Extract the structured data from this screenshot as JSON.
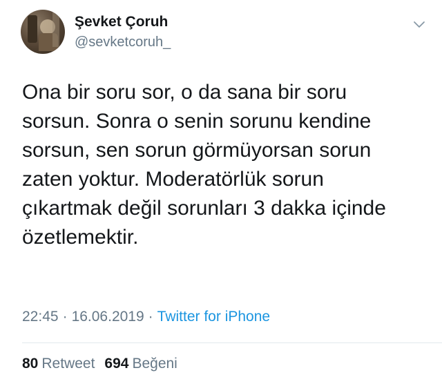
{
  "tweet": {
    "author": {
      "display_name": "Şevket Çoruh",
      "handle": "@sevketcoruh_"
    },
    "text": "Ona bir soru sor, o da sana bir soru\nsorsun. Sonra o senin sorunu kendine\nsorsun, sen sorun görmüyorsan sorun\nzaten yoktur. Moderatörlük sorun\nçıkartmak değil sorunları 3 dakka içinde\nözetlemektir.",
    "time": "22:45",
    "date": "16.06.2019",
    "separator": "·",
    "source": "Twitter for iPhone",
    "stats": {
      "retweets_count": "80",
      "retweets_label": "Retweet",
      "likes_count": "694",
      "likes_label": "Beğeni"
    }
  },
  "colors": {
    "text": "#14171a",
    "muted": "#657786",
    "link": "#1b95e0",
    "divider": "#e1e8ed"
  },
  "icons": {
    "menu": "chevron-down-icon"
  }
}
